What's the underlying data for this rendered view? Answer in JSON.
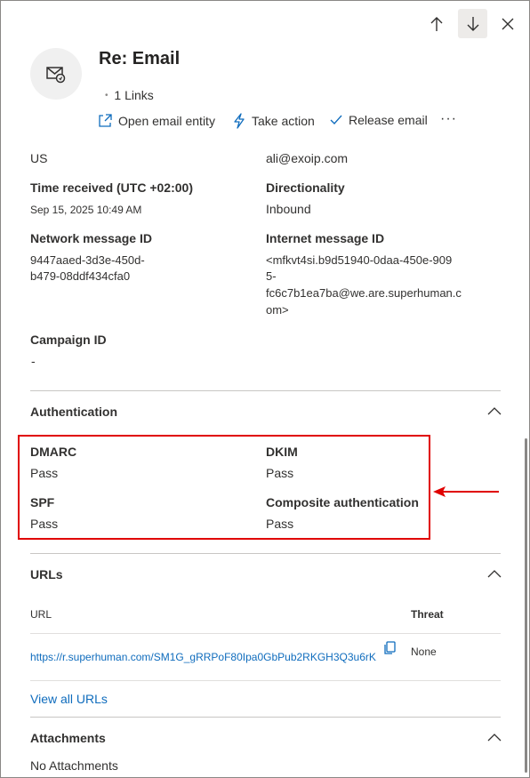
{
  "header": {
    "title": "Re: Email",
    "links": "1 Links",
    "actions": {
      "open_entity": "Open email entity",
      "take_action": "Take action",
      "release": "Release email",
      "more": "···"
    }
  },
  "details": {
    "country": "US",
    "recipient": "ali@exoip.com",
    "time_label": "Time received (UTC +02:00)",
    "time_value": "Sep 15, 2025 10:49 AM",
    "direction_label": "Directionality",
    "direction_value": "Inbound",
    "network_label": "Network message ID",
    "network_value_1": "9447aaed-3d3e-450d-",
    "network_value_2": "b479-08ddf434cfa0",
    "internet_label": "Internet message ID",
    "internet_value_1": "<mfkvt4si.b9d51940-0daa-450e-909",
    "internet_value_2": "5-",
    "internet_value_3": "fc6c7b1ea7ba@we.are.superhuman.c",
    "internet_value_4": "om>",
    "campaign_label": "Campaign ID",
    "campaign_value": "-"
  },
  "authentication": {
    "title": "Authentication",
    "dmarc_label": "DMARC",
    "dmarc_value": "Pass",
    "dkim_label": "DKIM",
    "dkim_value": "Pass",
    "spf_label": "SPF",
    "spf_value": "Pass",
    "composite_label": "Composite authentication",
    "composite_value": "Pass"
  },
  "urls": {
    "title": "URLs",
    "col_url": "URL",
    "col_threat": "Threat",
    "rows": [
      {
        "url": "https://r.superhuman.com/SM1G_gRRPoF80Ipa0GbPub2RKGH3Q3u6rK...",
        "threat": "None"
      }
    ],
    "view_all": "View all URLs"
  },
  "attachments": {
    "title": "Attachments",
    "value": "No Attachments"
  },
  "colors": {
    "highlight": "#e00000",
    "link": "#0f6cbd"
  },
  "icons": [
    "arrow-up-icon",
    "arrow-down-icon",
    "close-icon",
    "email-avatar-icon",
    "open-external-icon",
    "lightning-icon",
    "checkmark-icon",
    "more-icon",
    "chevron-up-icon",
    "copy-icon",
    "red-arrow-icon"
  ]
}
